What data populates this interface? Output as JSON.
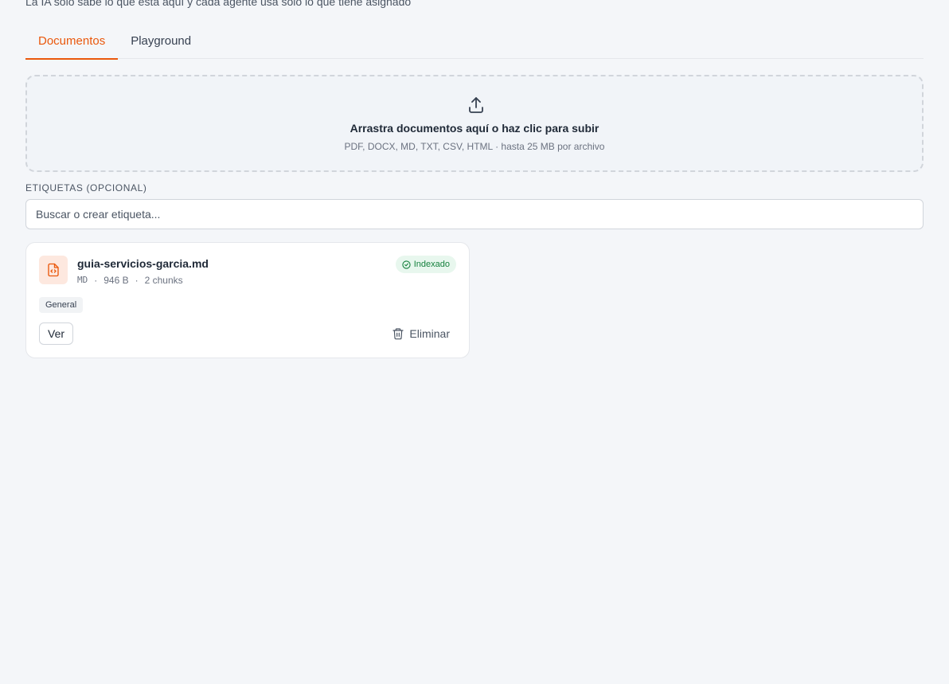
{
  "header": {
    "subtitle": "La IA solo sabe lo que está aquí y cada agente usa solo lo que tiene asignado"
  },
  "tabs": [
    {
      "label": "Documentos",
      "active": true
    },
    {
      "label": "Playground",
      "active": false
    }
  ],
  "dropzone": {
    "icon": "upload-icon",
    "title": "Arrastra documentos aquí o haz clic para subir",
    "hint": "PDF, DOCX, MD, TXT, CSV, HTML · hasta 25 MB por archivo"
  },
  "tags": {
    "label": "ETIQUETAS (OPCIONAL)",
    "placeholder": "Buscar o crear etiqueta..."
  },
  "documents": [
    {
      "icon": "file-code-icon",
      "name": "guia-servicios-garcia.md",
      "type": "MD",
      "size": "946 B",
      "chunks": "2 chunks",
      "status": "Indexado",
      "tags": [
        "General"
      ],
      "view_label": "Ver",
      "delete_label": "Eliminar"
    }
  ],
  "colors": {
    "accent": "#ea580c",
    "status_ok": "#15803d",
    "background": "#f4f6f9"
  }
}
